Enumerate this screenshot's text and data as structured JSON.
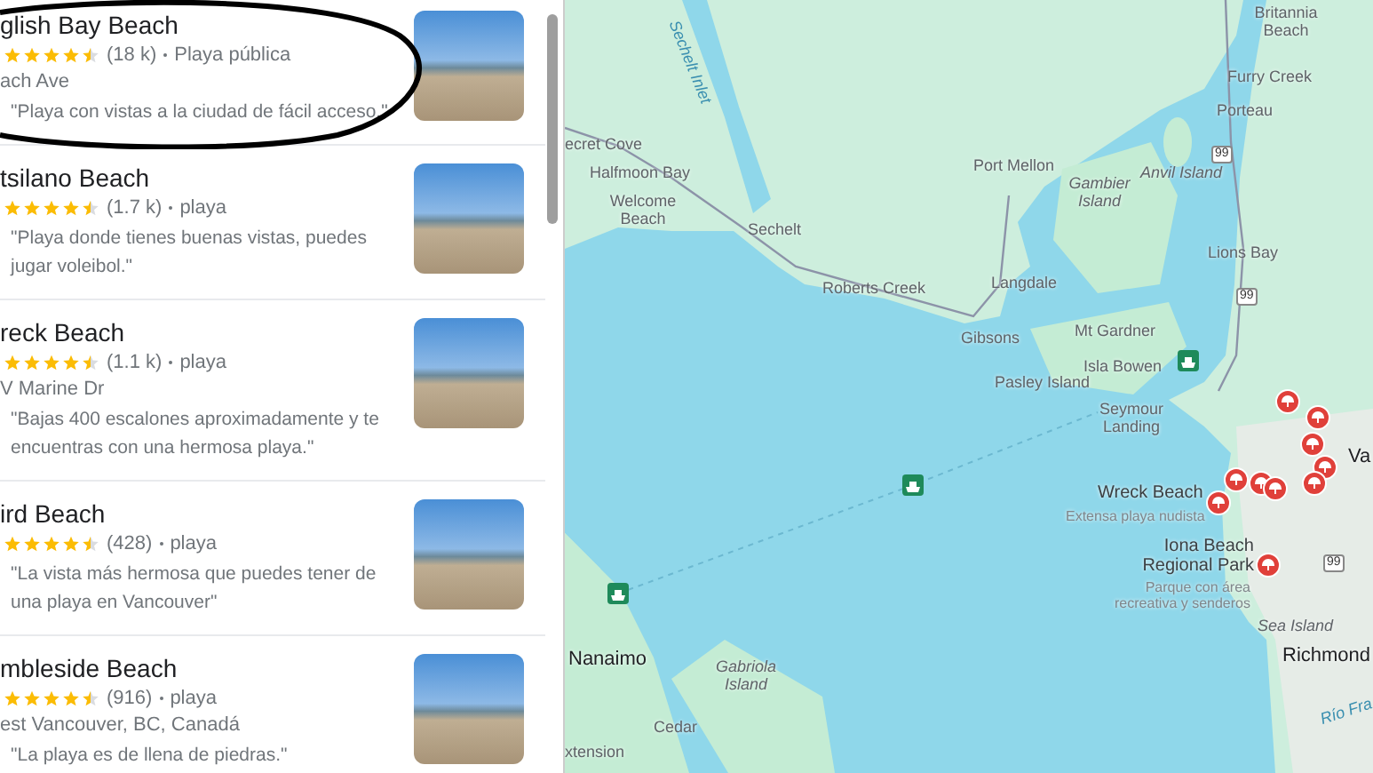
{
  "results": [
    {
      "name": "glish Bay Beach",
      "stars": 4.5,
      "count": "(18 k)",
      "category": "Playa pública",
      "address": "ach Ave",
      "review": "\"Playa con vistas a la ciudad de fácil acceso.\""
    },
    {
      "name": "tsilano Beach",
      "stars": 4.5,
      "count": "(1.7 k)",
      "category": "playa",
      "review": "\"Playa donde tienes buenas vistas, puedes jugar voleibol.\""
    },
    {
      "name": "reck Beach",
      "stars": 4.5,
      "count": "(1.1 k)",
      "category": "playa",
      "address": "V Marine Dr",
      "review": "\"Bajas 400 escalones aproximadamente y te encuentras con una hermosa playa.\""
    },
    {
      "name": "ird Beach",
      "stars": 4.5,
      "count": "(428)",
      "category": "playa",
      "review": "\"La vista más hermosa que puedes tener de una playa en Vancouver\""
    },
    {
      "name": "mbleside Beach",
      "stars": 4.5,
      "count": "(916)",
      "category": "playa",
      "address": "est Vancouver, BC, Canadá",
      "review": "\"La playa es de llena de piedras.\""
    }
  ],
  "map": {
    "labels": [
      {
        "text": "Britannia Beach",
        "kind": "place"
      },
      {
        "text": "Furry Creek",
        "kind": "place"
      },
      {
        "text": "Porteau",
        "kind": "place"
      },
      {
        "text": "ecret Cove",
        "kind": "place"
      },
      {
        "text": "Halfmoon Bay",
        "kind": "place"
      },
      {
        "text": "Welcome Beach",
        "kind": "place"
      },
      {
        "text": "Sechelt Inlet",
        "kind": "water"
      },
      {
        "text": "Sechelt",
        "kind": "place"
      },
      {
        "text": "Port Mellon",
        "kind": "place"
      },
      {
        "text": "Gambier Island",
        "kind": "island"
      },
      {
        "text": "Anvil Island",
        "kind": "island"
      },
      {
        "text": "Lions Bay",
        "kind": "place"
      },
      {
        "text": "Roberts Creek",
        "kind": "place"
      },
      {
        "text": "Langdale",
        "kind": "place"
      },
      {
        "text": "Gibsons",
        "kind": "place"
      },
      {
        "text": "Mt Gardner",
        "kind": "place"
      },
      {
        "text": "Isla Bowen",
        "kind": "place"
      },
      {
        "text": "Pasley Island",
        "kind": "place"
      },
      {
        "text": "Seymour Landing",
        "kind": "place"
      },
      {
        "text": "Wreck Beach",
        "kind": "poi"
      },
      {
        "text": "Extensa playa nudista",
        "kind": "sub"
      },
      {
        "text": "Iona Beach Regional Park",
        "kind": "poi"
      },
      {
        "text": "Parque con área recreativa y senderos",
        "kind": "sub"
      },
      {
        "text": "Va",
        "kind": "city"
      },
      {
        "text": "Sea Island",
        "kind": "island"
      },
      {
        "text": "Nanaimo",
        "kind": "city"
      },
      {
        "text": "Gabriola Island",
        "kind": "island"
      },
      {
        "text": "Cedar",
        "kind": "place"
      },
      {
        "text": "xtension",
        "kind": "place"
      },
      {
        "text": "Richmond",
        "kind": "city"
      },
      {
        "text": "Río Fra",
        "kind": "water"
      },
      {
        "text": "99",
        "kind": "shield"
      },
      {
        "text": "99",
        "kind": "shield"
      },
      {
        "text": "99",
        "kind": "shield"
      }
    ]
  }
}
